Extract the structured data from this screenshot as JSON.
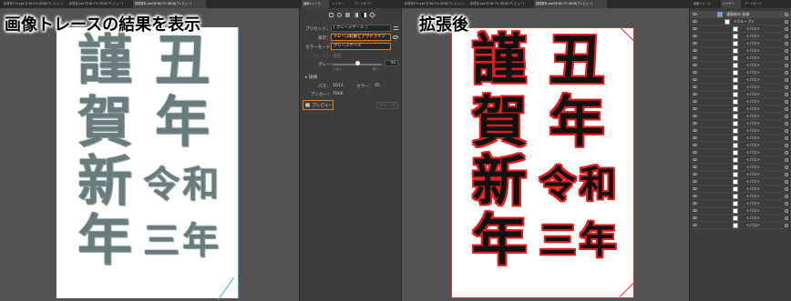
{
  "left": {
    "tabs": [
      "年賀状T13.psd @ 66.7% (RGB/プレビュー)",
      "年賀状.psd @ 66.7% (RGB/プレビュー)",
      "謹賀新年.psd @ 66.7% (RGB/プレビュー)"
    ],
    "caption": "画像トレースの結果を表示",
    "kanji": [
      "謹",
      "丑",
      "賀",
      "年",
      "新",
      "令",
      "和",
      "年",
      "三",
      "年"
    ]
  },
  "panel": {
    "tabs": [
      "画像トレース",
      "レイヤー",
      "アートボード"
    ],
    "preset_label": "プリセット：",
    "preset_value": "[ グレースケール ]",
    "view_label": "表示：",
    "view_value": "トレース結果とアウトライン",
    "mode_label": "カラーモード：",
    "mode_value": "グレースケール",
    "palette_label": "パレット：",
    "palette_value": "限定",
    "gray_label": "グレー：",
    "gray_value": "50",
    "gray_fraction": 0.5,
    "gray_min": "少なく",
    "gray_max": "多く",
    "detail_label": "詳細",
    "paths_label": "パス：",
    "paths_value": "1613",
    "colors_label": "カラー：",
    "colors_value": "45",
    "anchors_label": "アンカー：",
    "anchors_value": "7606",
    "preview_label": "プレビュー",
    "trace_button": "トレース"
  },
  "right": {
    "tabs": [
      "年賀状T13.psd @ 66.7% (RGB/プレビュー)",
      "年賀状.psd @ 66.7% (RGB/プレビュー)",
      "謹賀新年.psd @ 66.7% (RGB/プレビュー)"
    ],
    "caption": "拡張後",
    "kanji": [
      "謹",
      "丑",
      "賀",
      "年",
      "新",
      "令",
      "和",
      "年",
      "三",
      "年"
    ]
  },
  "layers": {
    "tabs": [
      "画像トレース",
      "レイヤー",
      "アートボード"
    ],
    "top_layer": "謹賀新年 画像",
    "group": "<グループ>",
    "path": "<パス>",
    "rows": 30
  }
}
